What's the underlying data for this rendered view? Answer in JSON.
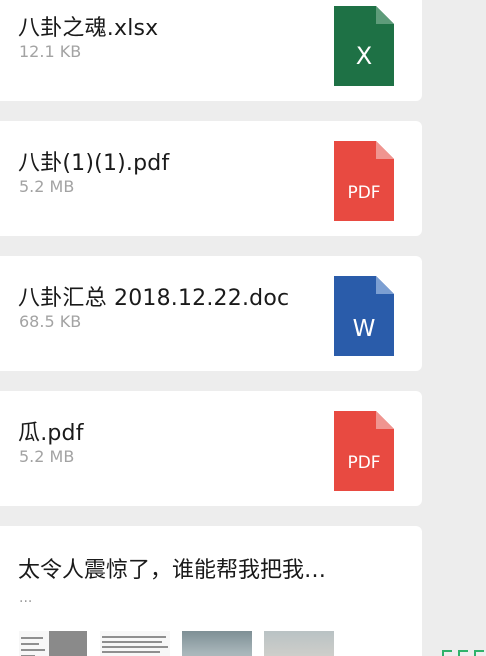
{
  "files": [
    {
      "name": "八卦之魂.xlsx",
      "size": "12.1 KB",
      "icon": "excel-file-icon",
      "icon_label": "X",
      "color": "#1e7145"
    },
    {
      "name": "八卦(1)(1).pdf",
      "size": "5.2 MB",
      "icon": "pdf-file-icon",
      "icon_label": "PDF",
      "color": "#e84a41"
    },
    {
      "name": "八卦汇总 2018.12.22.doc",
      "size": "68.5 KB",
      "icon": "word-file-icon",
      "icon_label": "W",
      "color": "#2a5caa"
    },
    {
      "name": "瓜.pdf",
      "size": "5.2 MB",
      "icon": "pdf-file-icon",
      "icon_label": "PDF",
      "color": "#e84a41"
    }
  ],
  "article": {
    "title": "太令人震惊了，谁能帮我把我…",
    "summary": "..."
  }
}
